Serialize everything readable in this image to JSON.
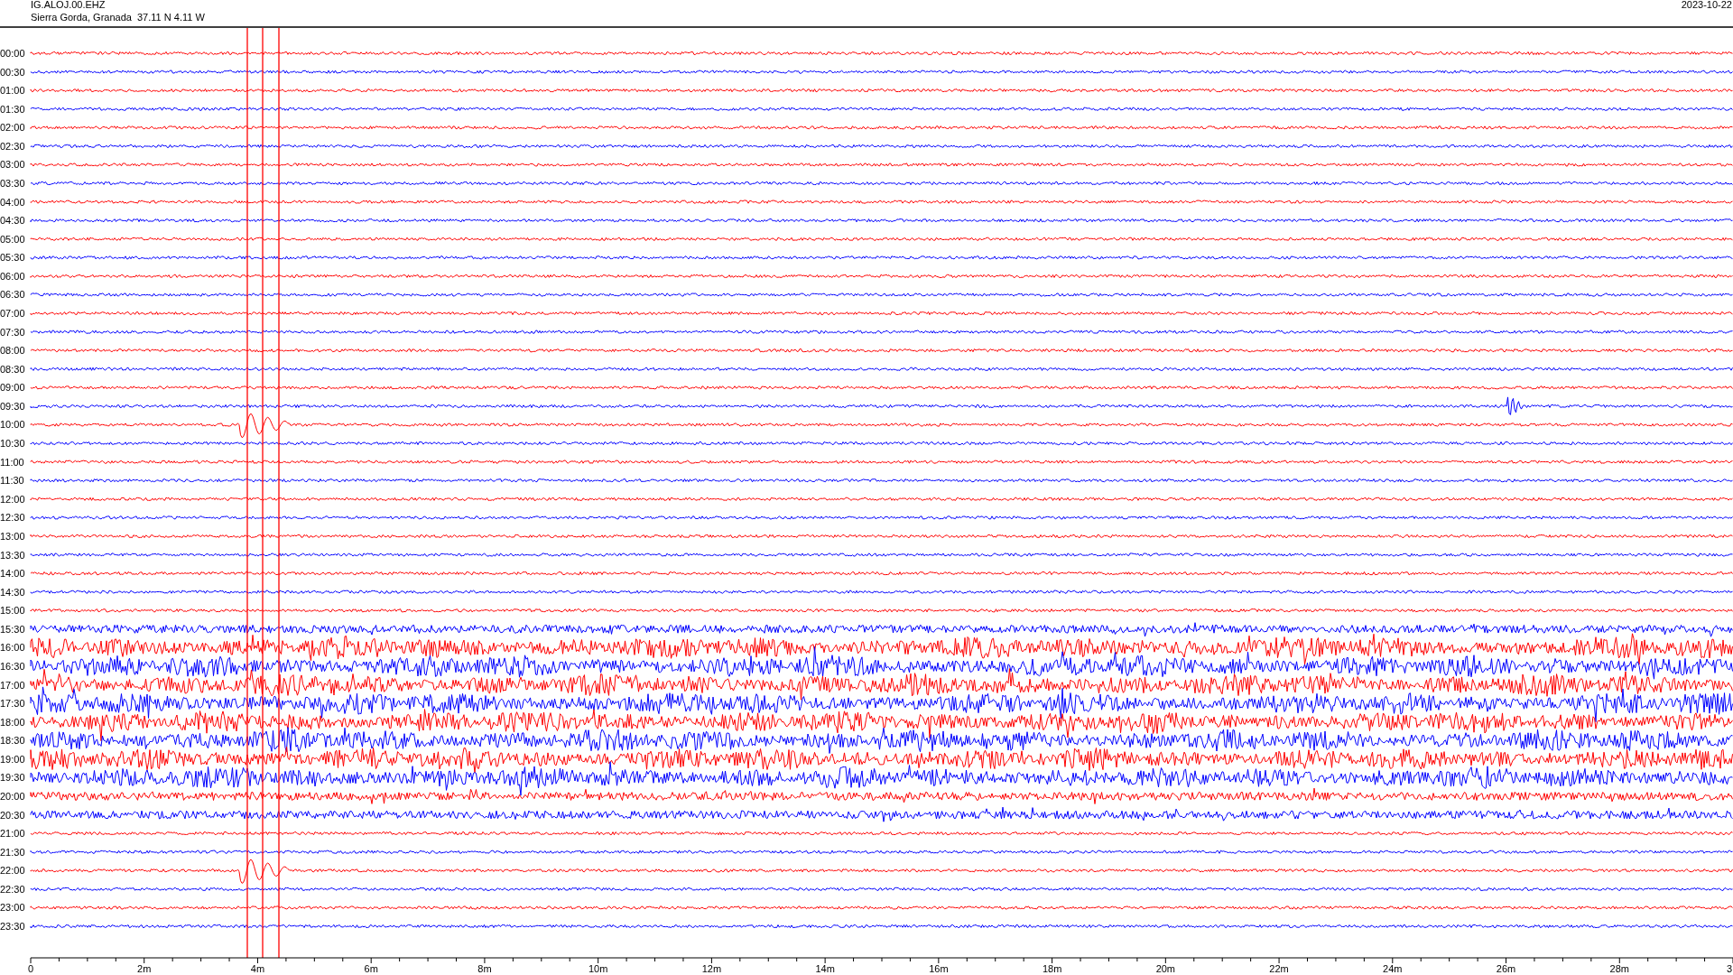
{
  "header": {
    "station": "IG.ALOJ.00.EHZ",
    "location": "Sierra Gorda, Granada  37.11 N 4.11 W",
    "date": "2023-10-22"
  },
  "rows": [
    {
      "label": "00:00",
      "color": "#ff0000",
      "kind": "quiet"
    },
    {
      "label": "00:30",
      "color": "#0000ff",
      "kind": "quiet"
    },
    {
      "label": "01:00",
      "color": "#ff0000",
      "kind": "quiet"
    },
    {
      "label": "01:30",
      "color": "#0000ff",
      "kind": "quiet"
    },
    {
      "label": "02:00",
      "color": "#ff0000",
      "kind": "quiet"
    },
    {
      "label": "02:30",
      "color": "#0000ff",
      "kind": "quiet"
    },
    {
      "label": "03:00",
      "color": "#ff0000",
      "kind": "quiet"
    },
    {
      "label": "03:30",
      "color": "#0000ff",
      "kind": "quiet"
    },
    {
      "label": "04:00",
      "color": "#ff0000",
      "kind": "quiet"
    },
    {
      "label": "04:30",
      "color": "#0000ff",
      "kind": "quiet"
    },
    {
      "label": "05:00",
      "color": "#ff0000",
      "kind": "quiet"
    },
    {
      "label": "05:30",
      "color": "#0000ff",
      "kind": "quiet"
    },
    {
      "label": "06:00",
      "color": "#ff0000",
      "kind": "quiet"
    },
    {
      "label": "06:30",
      "color": "#0000ff",
      "kind": "quiet"
    },
    {
      "label": "07:00",
      "color": "#ff0000",
      "kind": "quiet"
    },
    {
      "label": "07:30",
      "color": "#0000ff",
      "kind": "quiet"
    },
    {
      "label": "08:00",
      "color": "#ff0000",
      "kind": "quiet"
    },
    {
      "label": "08:30",
      "color": "#0000ff",
      "kind": "quiet"
    },
    {
      "label": "09:00",
      "color": "#ff0000",
      "kind": "quiet"
    },
    {
      "label": "09:30",
      "color": "#0000ff",
      "kind": "quiet"
    },
    {
      "label": "10:00",
      "color": "#ff0000",
      "kind": "quiet"
    },
    {
      "label": "10:30",
      "color": "#0000ff",
      "kind": "quiet"
    },
    {
      "label": "11:00",
      "color": "#ff0000",
      "kind": "quiet"
    },
    {
      "label": "11:30",
      "color": "#0000ff",
      "kind": "quiet"
    },
    {
      "label": "12:00",
      "color": "#ff0000",
      "kind": "quiet"
    },
    {
      "label": "12:30",
      "color": "#0000ff",
      "kind": "quiet"
    },
    {
      "label": "13:00",
      "color": "#ff0000",
      "kind": "quiet"
    },
    {
      "label": "13:30",
      "color": "#0000ff",
      "kind": "quiet"
    },
    {
      "label": "14:00",
      "color": "#ff0000",
      "kind": "quiet"
    },
    {
      "label": "14:30",
      "color": "#0000ff",
      "kind": "quiet"
    },
    {
      "label": "15:00",
      "color": "#ff0000",
      "kind": "quiet"
    },
    {
      "label": "15:30",
      "color": "#0000ff",
      "kind": "moderate"
    },
    {
      "label": "16:00",
      "color": "#ff0000",
      "kind": "noisy"
    },
    {
      "label": "16:30",
      "color": "#0000ff",
      "kind": "noisy"
    },
    {
      "label": "17:00",
      "color": "#ff0000",
      "kind": "noisy"
    },
    {
      "label": "17:30",
      "color": "#0000ff",
      "kind": "noisy"
    },
    {
      "label": "18:00",
      "color": "#ff0000",
      "kind": "noisy"
    },
    {
      "label": "18:30",
      "color": "#0000ff",
      "kind": "noisy"
    },
    {
      "label": "19:00",
      "color": "#ff0000",
      "kind": "noisy"
    },
    {
      "label": "19:30",
      "color": "#0000ff",
      "kind": "noisy"
    },
    {
      "label": "20:00",
      "color": "#ff0000",
      "kind": "moderate"
    },
    {
      "label": "20:30",
      "color": "#0000ff",
      "kind": "moderate"
    },
    {
      "label": "21:00",
      "color": "#ff0000",
      "kind": "quiet"
    },
    {
      "label": "21:30",
      "color": "#0000ff",
      "kind": "quiet"
    },
    {
      "label": "22:00",
      "color": "#ff0000",
      "kind": "quiet"
    },
    {
      "label": "22:30",
      "color": "#0000ff",
      "kind": "quiet"
    },
    {
      "label": "23:00",
      "color": "#ff0000",
      "kind": "quiet"
    },
    {
      "label": "23:30",
      "color": "#0000ff",
      "kind": "quiet"
    }
  ],
  "x_axis": {
    "labels": [
      "0",
      "2m",
      "4m",
      "6m",
      "8m",
      "10m",
      "12m",
      "14m",
      "16m",
      "18m",
      "20m",
      "22m",
      "24m",
      "26m",
      "28m",
      "3"
    ]
  }
}
